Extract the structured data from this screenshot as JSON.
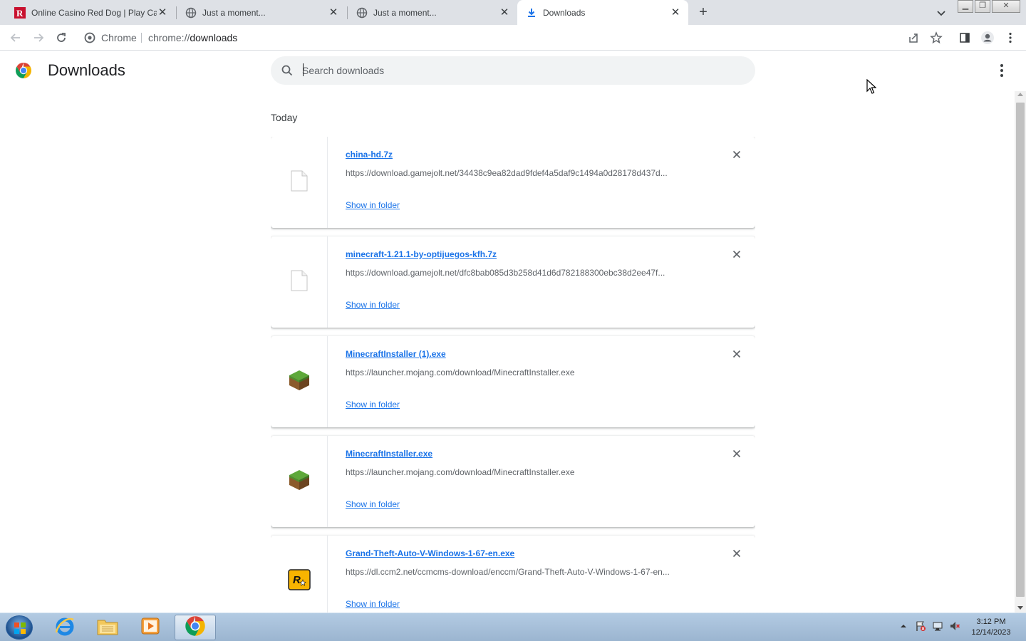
{
  "browser": {
    "tabs": [
      {
        "title": "Online Casino Red Dog | Play Ca",
        "favicon": "reddog-logo-icon",
        "active": false
      },
      {
        "title": "Just a moment...",
        "favicon": "globe-icon",
        "active": false
      },
      {
        "title": "Just a moment...",
        "favicon": "globe-icon",
        "active": false
      },
      {
        "title": "Downloads",
        "favicon": "download-icon",
        "active": true
      }
    ],
    "omnibox": {
      "origin_label": "Chrome",
      "url": "chrome://downloads",
      "url_scheme": "chrome://",
      "url_host": "downloads"
    }
  },
  "page": {
    "title": "Downloads",
    "search": {
      "placeholder": "Search downloads",
      "value": ""
    },
    "section": "Today"
  },
  "downloads": [
    {
      "name": "china-hd.7z",
      "url": "https://download.gamejolt.net/34438c9ea82dad9fdef4a5daf9c1494a0d28178d437d...",
      "action": "Show in folder",
      "icon": "generic-file-icon"
    },
    {
      "name": "minecraft-1.21.1-by-optijuegos-kfh.7z",
      "url": "https://download.gamejolt.net/dfc8bab085d3b258d41d6d782188300ebc38d2ee47f...",
      "action": "Show in folder",
      "icon": "generic-file-icon"
    },
    {
      "name": "MinecraftInstaller (1).exe",
      "url": "https://launcher.mojang.com/download/MinecraftInstaller.exe",
      "action": "Show in folder",
      "icon": "minecraft-grass-block-icon"
    },
    {
      "name": "MinecraftInstaller.exe",
      "url": "https://launcher.mojang.com/download/MinecraftInstaller.exe",
      "action": "Show in folder",
      "icon": "minecraft-grass-block-icon"
    },
    {
      "name": "Grand-Theft-Auto-V-Windows-1-67-en.exe",
      "url": "https://dl.ccm2.net/ccmcms-download/enccm/Grand-Theft-Auto-V-Windows-1-67-en...",
      "action": "Show in folder",
      "icon": "rockstar-logo-icon"
    }
  ],
  "taskbar": {
    "time": "3:12 PM",
    "date": "12/14/2023",
    "apps": [
      "internet-explorer-icon",
      "file-explorer-icon",
      "media-player-icon",
      "chrome-icon"
    ]
  },
  "colors": {
    "link": "#1a73e8",
    "tabstrip": "#dee1e6",
    "searchbox": "#f1f3f4",
    "taskbar": "#a9c1da"
  }
}
